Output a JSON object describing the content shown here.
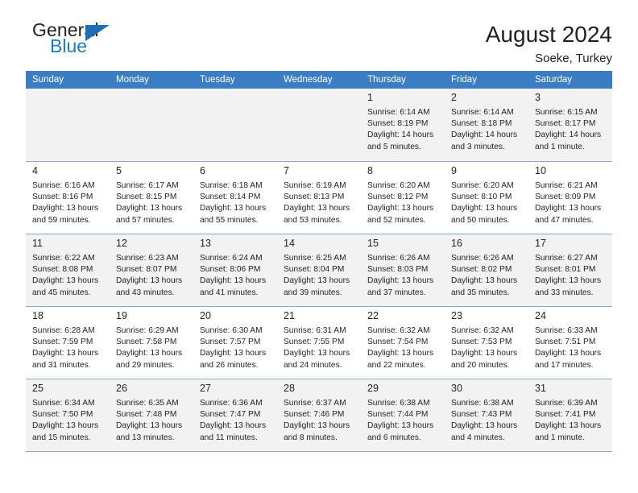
{
  "brand": {
    "line1": "General",
    "line2": "Blue",
    "logo_icon": "triangle-icon",
    "color_text": "#231f20",
    "color_blue": "#1f7bc1"
  },
  "header": {
    "title": "August 2024",
    "location": "Soeke, Turkey"
  },
  "theme": {
    "header_row_bg": "#3b7dc2",
    "header_row_text": "#ffffff",
    "shaded_cell_bg": "#f2f2f2",
    "grid_line": "#8fa9c4"
  },
  "weekday_headers": [
    "Sunday",
    "Monday",
    "Tuesday",
    "Wednesday",
    "Thursday",
    "Friday",
    "Saturday"
  ],
  "weeks": [
    {
      "shaded": true,
      "days": [
        {
          "day": "",
          "sunrise": "",
          "sunset": "",
          "daylight_line1": "",
          "daylight_line2": "",
          "empty": true
        },
        {
          "day": "",
          "sunrise": "",
          "sunset": "",
          "daylight_line1": "",
          "daylight_line2": "",
          "empty": true
        },
        {
          "day": "",
          "sunrise": "",
          "sunset": "",
          "daylight_line1": "",
          "daylight_line2": "",
          "empty": true
        },
        {
          "day": "",
          "sunrise": "",
          "sunset": "",
          "daylight_line1": "",
          "daylight_line2": "",
          "empty": true
        },
        {
          "day": "1",
          "sunrise": "Sunrise: 6:14 AM",
          "sunset": "Sunset: 8:19 PM",
          "daylight_line1": "Daylight: 14 hours",
          "daylight_line2": "and 5 minutes."
        },
        {
          "day": "2",
          "sunrise": "Sunrise: 6:14 AM",
          "sunset": "Sunset: 8:18 PM",
          "daylight_line1": "Daylight: 14 hours",
          "daylight_line2": "and 3 minutes."
        },
        {
          "day": "3",
          "sunrise": "Sunrise: 6:15 AM",
          "sunset": "Sunset: 8:17 PM",
          "daylight_line1": "Daylight: 14 hours",
          "daylight_line2": "and 1 minute."
        }
      ]
    },
    {
      "shaded": false,
      "days": [
        {
          "day": "4",
          "sunrise": "Sunrise: 6:16 AM",
          "sunset": "Sunset: 8:16 PM",
          "daylight_line1": "Daylight: 13 hours",
          "daylight_line2": "and 59 minutes."
        },
        {
          "day": "5",
          "sunrise": "Sunrise: 6:17 AM",
          "sunset": "Sunset: 8:15 PM",
          "daylight_line1": "Daylight: 13 hours",
          "daylight_line2": "and 57 minutes."
        },
        {
          "day": "6",
          "sunrise": "Sunrise: 6:18 AM",
          "sunset": "Sunset: 8:14 PM",
          "daylight_line1": "Daylight: 13 hours",
          "daylight_line2": "and 55 minutes."
        },
        {
          "day": "7",
          "sunrise": "Sunrise: 6:19 AM",
          "sunset": "Sunset: 8:13 PM",
          "daylight_line1": "Daylight: 13 hours",
          "daylight_line2": "and 53 minutes."
        },
        {
          "day": "8",
          "sunrise": "Sunrise: 6:20 AM",
          "sunset": "Sunset: 8:12 PM",
          "daylight_line1": "Daylight: 13 hours",
          "daylight_line2": "and 52 minutes."
        },
        {
          "day": "9",
          "sunrise": "Sunrise: 6:20 AM",
          "sunset": "Sunset: 8:10 PM",
          "daylight_line1": "Daylight: 13 hours",
          "daylight_line2": "and 50 minutes."
        },
        {
          "day": "10",
          "sunrise": "Sunrise: 6:21 AM",
          "sunset": "Sunset: 8:09 PM",
          "daylight_line1": "Daylight: 13 hours",
          "daylight_line2": "and 47 minutes."
        }
      ]
    },
    {
      "shaded": true,
      "days": [
        {
          "day": "11",
          "sunrise": "Sunrise: 6:22 AM",
          "sunset": "Sunset: 8:08 PM",
          "daylight_line1": "Daylight: 13 hours",
          "daylight_line2": "and 45 minutes."
        },
        {
          "day": "12",
          "sunrise": "Sunrise: 6:23 AM",
          "sunset": "Sunset: 8:07 PM",
          "daylight_line1": "Daylight: 13 hours",
          "daylight_line2": "and 43 minutes."
        },
        {
          "day": "13",
          "sunrise": "Sunrise: 6:24 AM",
          "sunset": "Sunset: 8:06 PM",
          "daylight_line1": "Daylight: 13 hours",
          "daylight_line2": "and 41 minutes."
        },
        {
          "day": "14",
          "sunrise": "Sunrise: 6:25 AM",
          "sunset": "Sunset: 8:04 PM",
          "daylight_line1": "Daylight: 13 hours",
          "daylight_line2": "and 39 minutes."
        },
        {
          "day": "15",
          "sunrise": "Sunrise: 6:26 AM",
          "sunset": "Sunset: 8:03 PM",
          "daylight_line1": "Daylight: 13 hours",
          "daylight_line2": "and 37 minutes."
        },
        {
          "day": "16",
          "sunrise": "Sunrise: 6:26 AM",
          "sunset": "Sunset: 8:02 PM",
          "daylight_line1": "Daylight: 13 hours",
          "daylight_line2": "and 35 minutes."
        },
        {
          "day": "17",
          "sunrise": "Sunrise: 6:27 AM",
          "sunset": "Sunset: 8:01 PM",
          "daylight_line1": "Daylight: 13 hours",
          "daylight_line2": "and 33 minutes."
        }
      ]
    },
    {
      "shaded": false,
      "days": [
        {
          "day": "18",
          "sunrise": "Sunrise: 6:28 AM",
          "sunset": "Sunset: 7:59 PM",
          "daylight_line1": "Daylight: 13 hours",
          "daylight_line2": "and 31 minutes."
        },
        {
          "day": "19",
          "sunrise": "Sunrise: 6:29 AM",
          "sunset": "Sunset: 7:58 PM",
          "daylight_line1": "Daylight: 13 hours",
          "daylight_line2": "and 29 minutes."
        },
        {
          "day": "20",
          "sunrise": "Sunrise: 6:30 AM",
          "sunset": "Sunset: 7:57 PM",
          "daylight_line1": "Daylight: 13 hours",
          "daylight_line2": "and 26 minutes."
        },
        {
          "day": "21",
          "sunrise": "Sunrise: 6:31 AM",
          "sunset": "Sunset: 7:55 PM",
          "daylight_line1": "Daylight: 13 hours",
          "daylight_line2": "and 24 minutes."
        },
        {
          "day": "22",
          "sunrise": "Sunrise: 6:32 AM",
          "sunset": "Sunset: 7:54 PM",
          "daylight_line1": "Daylight: 13 hours",
          "daylight_line2": "and 22 minutes."
        },
        {
          "day": "23",
          "sunrise": "Sunrise: 6:32 AM",
          "sunset": "Sunset: 7:53 PM",
          "daylight_line1": "Daylight: 13 hours",
          "daylight_line2": "and 20 minutes."
        },
        {
          "day": "24",
          "sunrise": "Sunrise: 6:33 AM",
          "sunset": "Sunset: 7:51 PM",
          "daylight_line1": "Daylight: 13 hours",
          "daylight_line2": "and 17 minutes."
        }
      ]
    },
    {
      "shaded": true,
      "days": [
        {
          "day": "25",
          "sunrise": "Sunrise: 6:34 AM",
          "sunset": "Sunset: 7:50 PM",
          "daylight_line1": "Daylight: 13 hours",
          "daylight_line2": "and 15 minutes."
        },
        {
          "day": "26",
          "sunrise": "Sunrise: 6:35 AM",
          "sunset": "Sunset: 7:48 PM",
          "daylight_line1": "Daylight: 13 hours",
          "daylight_line2": "and 13 minutes."
        },
        {
          "day": "27",
          "sunrise": "Sunrise: 6:36 AM",
          "sunset": "Sunset: 7:47 PM",
          "daylight_line1": "Daylight: 13 hours",
          "daylight_line2": "and 11 minutes."
        },
        {
          "day": "28",
          "sunrise": "Sunrise: 6:37 AM",
          "sunset": "Sunset: 7:46 PM",
          "daylight_line1": "Daylight: 13 hours",
          "daylight_line2": "and 8 minutes."
        },
        {
          "day": "29",
          "sunrise": "Sunrise: 6:38 AM",
          "sunset": "Sunset: 7:44 PM",
          "daylight_line1": "Daylight: 13 hours",
          "daylight_line2": "and 6 minutes."
        },
        {
          "day": "30",
          "sunrise": "Sunrise: 6:38 AM",
          "sunset": "Sunset: 7:43 PM",
          "daylight_line1": "Daylight: 13 hours",
          "daylight_line2": "and 4 minutes."
        },
        {
          "day": "31",
          "sunrise": "Sunrise: 6:39 AM",
          "sunset": "Sunset: 7:41 PM",
          "daylight_line1": "Daylight: 13 hours",
          "daylight_line2": "and 1 minute."
        }
      ]
    }
  ]
}
